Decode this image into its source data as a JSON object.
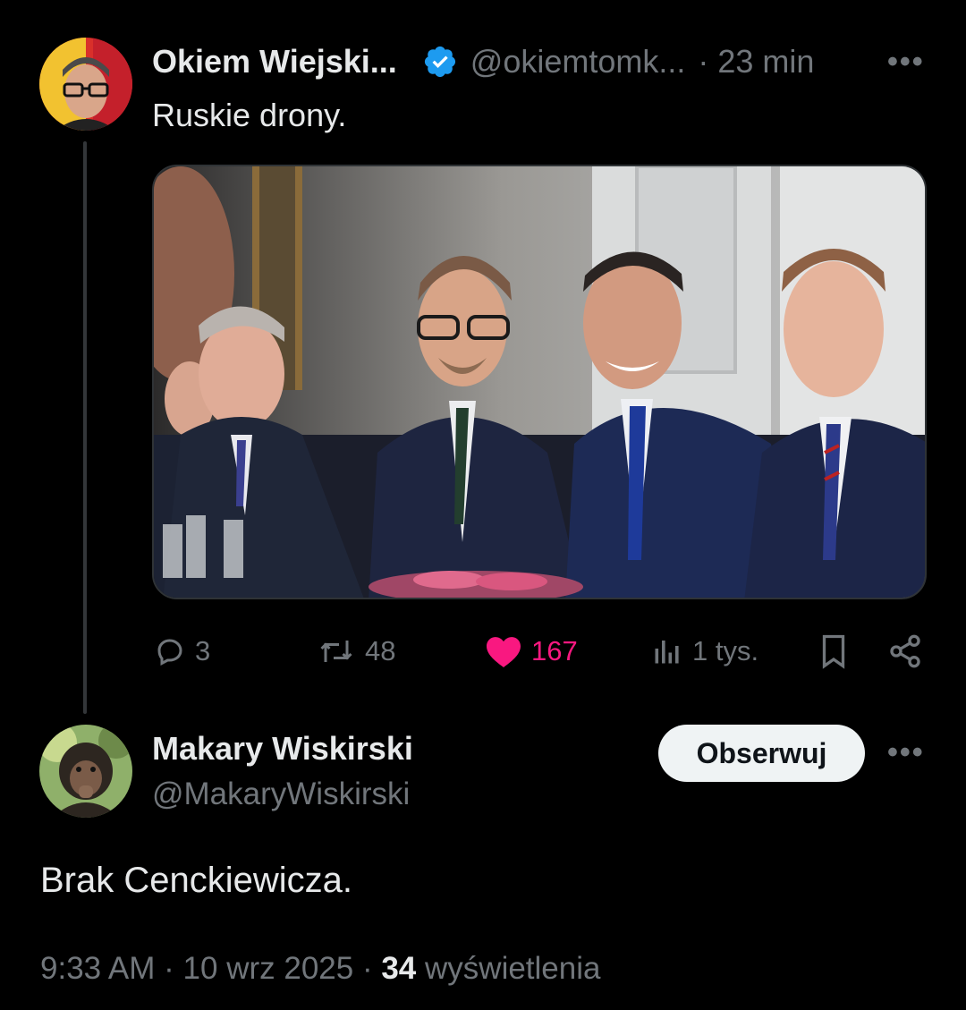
{
  "tweet": {
    "author_name": "Okiem Wiejski...",
    "handle": "@okiemtomk...",
    "separator": "·",
    "time": "23 min",
    "more_label": "•••",
    "text": "Ruskie drony.",
    "verified_icon": "verified-badge-icon",
    "verified_color": "#1d9bf0",
    "actions": {
      "replies": "3",
      "reposts": "48",
      "likes": "167",
      "views": "1 tys."
    },
    "liked": true,
    "like_color": "#f91880"
  },
  "reply": {
    "author_name": "Makary Wiskirski",
    "handle": "@MakaryWiskirski",
    "follow_label": "Obserwuj",
    "more_label": "•••",
    "text": "Brak Cenckiewicza.",
    "time": "9:33 AM",
    "date": "10 wrz 2025",
    "views_count": "34",
    "views_label": "wyświetlenia"
  }
}
